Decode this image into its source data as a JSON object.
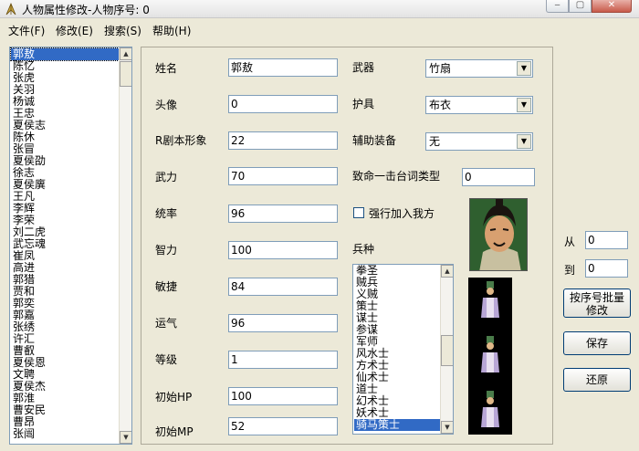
{
  "window": {
    "title": "人物属性修改-人物序号: 0",
    "min_icon": "minimize-icon",
    "max_icon": "maximize-icon",
    "close_icon": "close-icon",
    "close_glyph": "✕"
  },
  "menu": {
    "items": [
      "文件(F)",
      "修改(E)",
      "搜索(S)",
      "帮助(H)"
    ]
  },
  "character_list": {
    "selected_index": 0,
    "items": [
      "郭敖",
      "陈忆",
      "张虎",
      "关羽",
      "杨诚",
      "王忠",
      "夏侯志",
      "陈休",
      "张冒",
      "夏侯劭",
      "徐志",
      "夏侯廙",
      "王凡",
      "李辉",
      "李荣",
      "刘二虎",
      "武忘魂",
      "崔凤",
      "高进",
      "郭猎",
      "贾和",
      "郭奕",
      "郭嘉",
      "张绣",
      "许汇",
      "曹叡",
      "夏侯恩",
      "文聘",
      "夏侯杰",
      "郭淮",
      "曹安民",
      "曹昂",
      "张闿"
    ]
  },
  "fields": {
    "name": {
      "label": "姓名",
      "value": "郭敖"
    },
    "avatar": {
      "label": "头像",
      "value": "0"
    },
    "r_script_image": {
      "label": "R剧本形象",
      "value": "22"
    },
    "force": {
      "label": "武力",
      "value": "70"
    },
    "command": {
      "label": "统率",
      "value": "96"
    },
    "intellect": {
      "label": "智力",
      "value": "100"
    },
    "agility": {
      "label": "敏捷",
      "value": "84"
    },
    "luck": {
      "label": "运气",
      "value": "96"
    },
    "level": {
      "label": "等级",
      "value": "1"
    },
    "initial_hp": {
      "label": "初始HP",
      "value": "100"
    },
    "initial_mp": {
      "label": "初始MP",
      "value": "52"
    }
  },
  "equipment": {
    "weapon": {
      "label": "武器",
      "value": "竹扇"
    },
    "armor": {
      "label": "护具",
      "value": "布衣"
    },
    "accessory": {
      "label": "辅助装备",
      "value": "无"
    },
    "finisher": {
      "label": "致命一击台词类型",
      "value": "0"
    }
  },
  "force_join": {
    "label": "强行加入我方",
    "checked": false
  },
  "unit_type": {
    "label": "兵种",
    "items": [
      "拳圣",
      "贼兵",
      "义贼",
      "策士",
      "谋士",
      "参谋",
      "军师",
      "风水士",
      "方术士",
      "仙术士",
      "道士",
      "幻术士",
      "妖术士",
      "骑马策士"
    ],
    "selected_index": 13
  },
  "batch": {
    "from_label": "从",
    "from_value": "0",
    "to_label": "到",
    "to_value": "0",
    "batch_button": "按序号批量修改",
    "batch_line1": "按序号批量",
    "batch_line2": "修改",
    "save_button": "保存",
    "restore_button": "还原"
  },
  "colors": {
    "selection": "#316ac5",
    "face_bg": "#3a6d3a",
    "robe": "#b8a6d6"
  }
}
